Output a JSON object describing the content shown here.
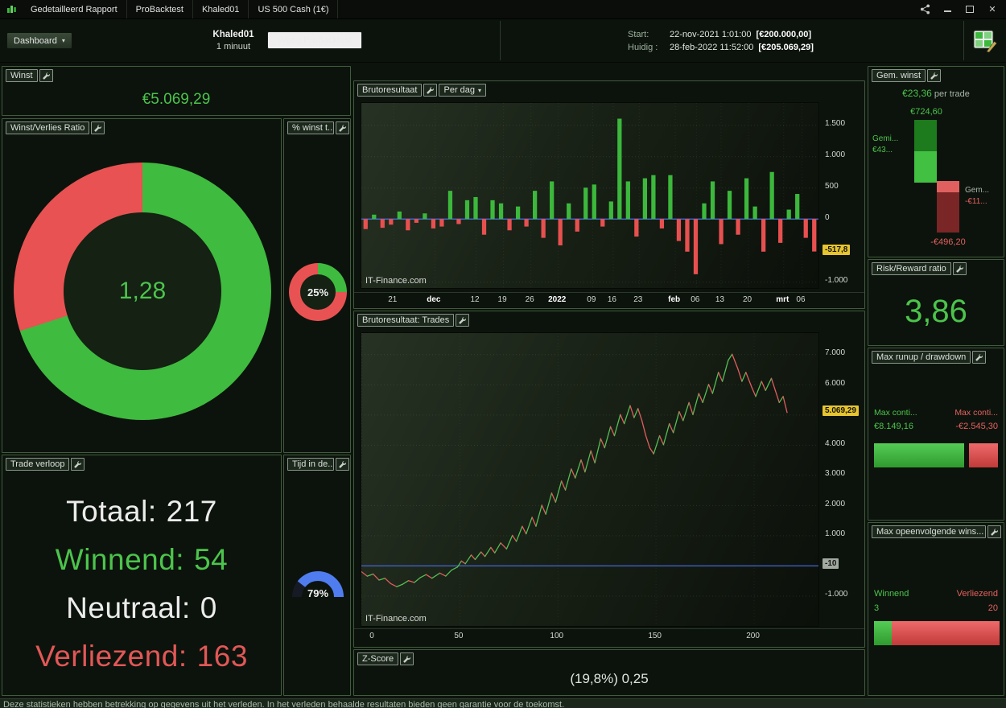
{
  "colors": {
    "green": "#3fbb3f",
    "red": "#e85252",
    "blue": "#4b6fe8",
    "highlight_yellow": "#e7c431"
  },
  "titlebar": {
    "tabs": [
      {
        "label": "Gedetailleerd Rapport"
      },
      {
        "label": "ProBacktest"
      },
      {
        "label": "Khaled01"
      },
      {
        "label": "US 500 Cash (1€)"
      }
    ]
  },
  "toolbar": {
    "dashboard": "Dashboard",
    "account": "Khaled01",
    "timeframe": "1 minuut",
    "edit_button": "Wijzig ProBacktest",
    "start_label": "Start:",
    "start_datetime": "22-nov-2021 1:01:00",
    "start_amount": "[€200.000,00]",
    "current_label": "Huidig :",
    "current_datetime": "28-feb-2022 11:52:00",
    "current_amount": "[€205.069,29]"
  },
  "panels": {
    "winst": {
      "title": "Winst",
      "value": "€5.069,29"
    },
    "ratio": {
      "title": "Winst/Verlies Ratio",
      "value": "1,28",
      "green_pct": 70
    },
    "pct_winst": {
      "title": "% winst t...",
      "value": "25%",
      "green_pct": 25
    },
    "verloop": {
      "title": "Trade verloop",
      "rows": [
        {
          "label": "Totaal:",
          "value": "217"
        },
        {
          "label": "Winnend:",
          "value": "54"
        },
        {
          "label": "Neutraal:",
          "value": "0"
        },
        {
          "label": "Verliezend:",
          "value": "163"
        }
      ]
    },
    "tijd": {
      "title": "Tijd in de...",
      "value": "79%",
      "pct": 79
    },
    "zscore": {
      "title": "Z-Score",
      "value": "(19,8%) 0,25"
    },
    "gem_winst": {
      "title": "Gem. winst",
      "per_trade_value": "€23,36",
      "per_trade_suffix": "per trade",
      "max_win": "€724,60",
      "max_win_v": 724.6,
      "avg_win_label": "Gemi...",
      "avg_win_value": "€43...",
      "avg_loss_label": "Gem...",
      "avg_loss_value": "-€11...",
      "max_loss": "-€496,20",
      "max_loss_v": 496.2
    },
    "risk_reward": {
      "title": "Risk/Reward ratio",
      "value": "3,86"
    },
    "runup": {
      "title": "Max runup / drawdown",
      "left_label": "Max conti...",
      "left_value": "€8.149,16",
      "right_label": "Max conti...",
      "right_value": "-€2.545,30",
      "green_frac": 0.72,
      "red_frac": 0.23
    },
    "streak": {
      "title": "Max opeenvolgende wins...",
      "win_label": "Winnend",
      "win_value": "3",
      "loss_label": "Verliezend",
      "loss_value": "20",
      "green_frac": 0.14,
      "red_frac": 0.86
    }
  },
  "chart_data": [
    {
      "type": "bar",
      "title": "Brutoresultaat",
      "period_selector": "Per dag",
      "watermark": "IT-Finance.com",
      "ylim": [
        -1100,
        1850
      ],
      "yticks": [
        {
          "v": 1500,
          "label": "1.500"
        },
        {
          "v": 1000,
          "label": "1.000"
        },
        {
          "v": 500,
          "label": "500"
        },
        {
          "v": 0,
          "label": "0"
        },
        {
          "v": -1000,
          "label": "-1.000"
        }
      ],
      "current": {
        "v": -517.8,
        "label": "-517,8"
      },
      "baseline": {
        "v": 0,
        "label": ""
      },
      "xticks": [
        {
          "label": "21",
          "frac": 0.07
        },
        {
          "label": "dec",
          "frac": 0.16,
          "bold": true
        },
        {
          "label": "12",
          "frac": 0.25
        },
        {
          "label": "19",
          "frac": 0.31
        },
        {
          "label": "26",
          "frac": 0.37
        },
        {
          "label": "2022",
          "frac": 0.43,
          "bold": true
        },
        {
          "label": "09",
          "frac": 0.505
        },
        {
          "label": "16",
          "frac": 0.55
        },
        {
          "label": "23",
          "frac": 0.607
        },
        {
          "label": "feb",
          "frac": 0.686,
          "bold": true
        },
        {
          "label": "06",
          "frac": 0.732
        },
        {
          "label": "13",
          "frac": 0.786
        },
        {
          "label": "20",
          "frac": 0.846
        },
        {
          "label": "mrt",
          "frac": 0.923,
          "bold": true
        },
        {
          "label": "06",
          "frac": 0.963
        }
      ],
      "values": [
        -160,
        70,
        -140,
        -90,
        120,
        -180,
        -60,
        90,
        -150,
        -120,
        450,
        -80,
        300,
        350,
        -250,
        300,
        250,
        -180,
        200,
        -120,
        450,
        -300,
        600,
        -420,
        250,
        -200,
        500,
        550,
        -120,
        280,
        1600,
        600,
        -280,
        650,
        700,
        -150,
        700,
        -350,
        -520,
        -880,
        250,
        600,
        -400,
        450,
        -250,
        650,
        200,
        -520,
        750,
        -380,
        150,
        400,
        -300,
        -517.8
      ],
      "colors": {
        "up": "#3cb83c",
        "down": "#e85050"
      }
    },
    {
      "type": "line",
      "title": "Brutoresultaat: Trades",
      "watermark": "IT-Finance.com",
      "xlim": [
        0,
        233
      ],
      "ylim": [
        -2000,
        7700
      ],
      "yticks": [
        {
          "v": 7000,
          "label": "7.000"
        },
        {
          "v": 6000,
          "label": "6.000"
        },
        {
          "v": 5000,
          "label": "5.000"
        },
        {
          "v": 4000,
          "label": "4.000"
        },
        {
          "v": 3000,
          "label": "3.000"
        },
        {
          "v": 2000,
          "label": "2.000"
        },
        {
          "v": 1000,
          "label": "1.000"
        },
        {
          "v": -1000,
          "label": "-1.000"
        }
      ],
      "baseline": {
        "v": -10,
        "label": "-10"
      },
      "current": {
        "v": 5069.29,
        "label": "5.069,29"
      },
      "xticks": [
        {
          "label": "0",
          "x": 0
        },
        {
          "label": "50",
          "x": 50
        },
        {
          "label": "100",
          "x": 100
        },
        {
          "label": "150",
          "x": 150
        },
        {
          "label": "200",
          "x": 200
        }
      ],
      "points": [
        [
          0,
          -200
        ],
        [
          3,
          -350
        ],
        [
          6,
          -280
        ],
        [
          9,
          -480
        ],
        [
          12,
          -420
        ],
        [
          15,
          -600
        ],
        [
          18,
          -700
        ],
        [
          21,
          -620
        ],
        [
          24,
          -500
        ],
        [
          27,
          -560
        ],
        [
          30,
          -400
        ],
        [
          33,
          -300
        ],
        [
          36,
          -420
        ],
        [
          40,
          -250
        ],
        [
          43,
          -350
        ],
        [
          46,
          -150
        ],
        [
          49,
          -50
        ],
        [
          51,
          150
        ],
        [
          53,
          60
        ],
        [
          56,
          350
        ],
        [
          58,
          200
        ],
        [
          61,
          450
        ],
        [
          63,
          300
        ],
        [
          66,
          600
        ],
        [
          68,
          420
        ],
        [
          71,
          750
        ],
        [
          74,
          550
        ],
        [
          77,
          1000
        ],
        [
          79,
          800
        ],
        [
          82,
          1300
        ],
        [
          84,
          1050
        ],
        [
          87,
          1600
        ],
        [
          89,
          1300
        ],
        [
          92,
          2000
        ],
        [
          94,
          1700
        ],
        [
          97,
          2400
        ],
        [
          99,
          2100
        ],
        [
          102,
          2800
        ],
        [
          104,
          2500
        ],
        [
          107,
          3200
        ],
        [
          109,
          2900
        ],
        [
          112,
          3500
        ],
        [
          114,
          3100
        ],
        [
          117,
          3800
        ],
        [
          119,
          3400
        ],
        [
          122,
          4200
        ],
        [
          124,
          3900
        ],
        [
          127,
          4600
        ],
        [
          129,
          4300
        ],
        [
          132,
          5000
        ],
        [
          134,
          4700
        ],
        [
          137,
          5300
        ],
        [
          139,
          4900
        ],
        [
          141,
          5200
        ],
        [
          143,
          4800
        ],
        [
          145,
          4300
        ],
        [
          147,
          3900
        ],
        [
          149,
          3700
        ],
        [
          152,
          4300
        ],
        [
          154,
          4000
        ],
        [
          157,
          4700
        ],
        [
          159,
          4400
        ],
        [
          162,
          5100
        ],
        [
          164,
          4800
        ],
        [
          167,
          5400
        ],
        [
          169,
          5000
        ],
        [
          172,
          5700
        ],
        [
          174,
          5400
        ],
        [
          177,
          6000
        ],
        [
          179,
          5700
        ],
        [
          182,
          6400
        ],
        [
          184,
          6100
        ],
        [
          187,
          6800
        ],
        [
          189,
          7000
        ],
        [
          192,
          6500
        ],
        [
          194,
          6100
        ],
        [
          196,
          6400
        ],
        [
          199,
          5900
        ],
        [
          201,
          5600
        ],
        [
          204,
          6100
        ],
        [
          206,
          5800
        ],
        [
          209,
          6200
        ],
        [
          211,
          5800
        ],
        [
          213,
          5400
        ],
        [
          215,
          5600
        ],
        [
          217,
          5069
        ]
      ],
      "colors": {
        "up": "#55bd55",
        "down": "#e05d5d"
      }
    }
  ],
  "footer": "Deze statistieken hebben betrekking op gegevens uit het verleden. In het verleden behaalde resultaten bieden geen garantie voor de toekomst."
}
